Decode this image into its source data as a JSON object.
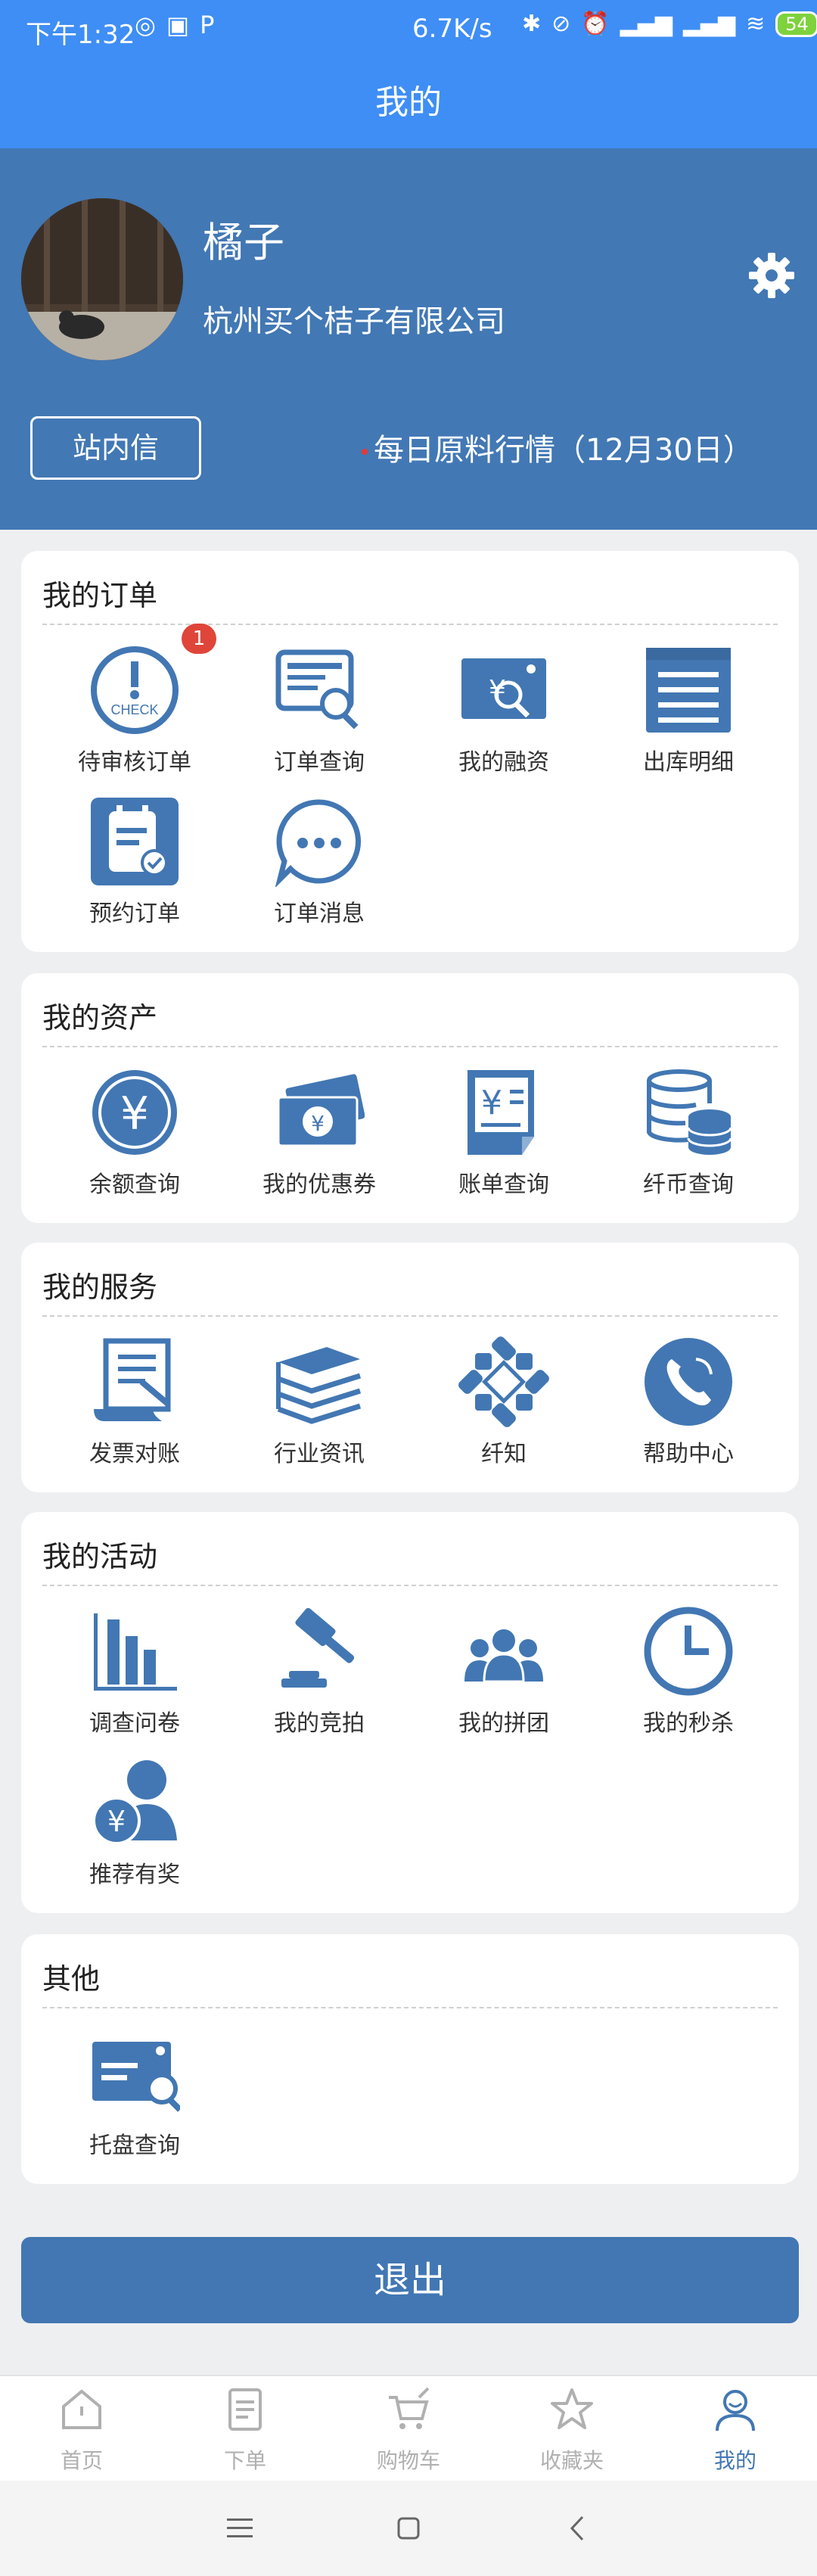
{
  "status": {
    "time": "下午1:32",
    "speed": "6.7K/s",
    "battery": "54"
  },
  "header": {
    "title": "我的"
  },
  "profile": {
    "name": "橘子",
    "company": "杭州买个桔子有限公司",
    "inbox_label": "站内信",
    "daily_label": "每日原料行情（12月30日）"
  },
  "orders": {
    "title": "我的订单",
    "badge": "1",
    "items": [
      "待审核订单",
      "订单查询",
      "我的融资",
      "出库明细",
      "预约订单",
      "订单消息"
    ]
  },
  "assets": {
    "title": "我的资产",
    "items": [
      "余额查询",
      "我的优惠券",
      "账单查询",
      "纤币查询"
    ]
  },
  "services": {
    "title": "我的服务",
    "items": [
      "发票对账",
      "行业资讯",
      "纤知",
      "帮助中心"
    ]
  },
  "activities": {
    "title": "我的活动",
    "items": [
      "调查问卷",
      "我的竞拍",
      "我的拼团",
      "我的秒杀",
      "推荐有奖"
    ]
  },
  "other": {
    "title": "其他",
    "items": [
      "托盘查询"
    ]
  },
  "logout_label": "退出",
  "tabs": [
    "首页",
    "下单",
    "购物车",
    "收藏夹",
    "我的"
  ],
  "colors": {
    "brand": "#4277b3",
    "status_bar": "#3f8ef5",
    "badge": "#e0453a"
  }
}
